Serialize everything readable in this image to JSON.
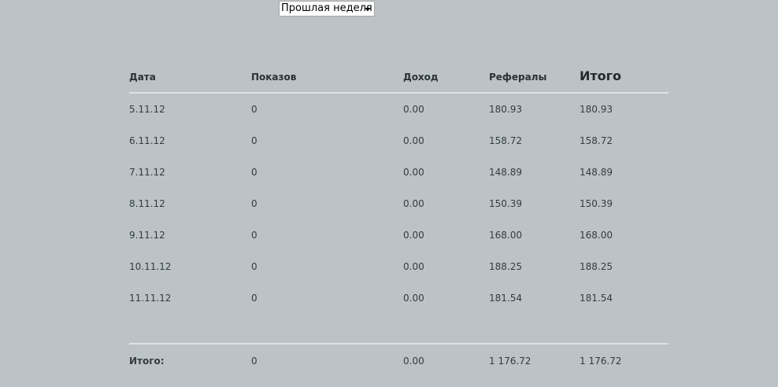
{
  "filter": {
    "period_selected": "Прошлая неделя",
    "arrow_icon": "caret-down-icon"
  },
  "table": {
    "headers": {
      "date": "Дата",
      "impressions": "Показов",
      "income": "Доход",
      "referrals": "Рефералы",
      "total": "Итого"
    },
    "rows": [
      {
        "date": "5.11.12",
        "impressions": "0",
        "income": "0.00",
        "referrals": "180.93",
        "total": "180.93"
      },
      {
        "date": "6.11.12",
        "impressions": "0",
        "income": "0.00",
        "referrals": "158.72",
        "total": "158.72"
      },
      {
        "date": "7.11.12",
        "impressions": "0",
        "income": "0.00",
        "referrals": "148.89",
        "total": "148.89"
      },
      {
        "date": "8.11.12",
        "impressions": "0",
        "income": "0.00",
        "referrals": "150.39",
        "total": "150.39"
      },
      {
        "date": "9.11.12",
        "impressions": "0",
        "income": "0.00",
        "referrals": "168.00",
        "total": "168.00"
      },
      {
        "date": "10.11.12",
        "impressions": "0",
        "income": "0.00",
        "referrals": "188.25",
        "total": "188.25"
      },
      {
        "date": "11.11.12",
        "impressions": "0",
        "income": "0.00",
        "referrals": "181.54",
        "total": "181.54"
      }
    ],
    "footer": {
      "label": "Итого:",
      "impressions": "0",
      "income": "0.00",
      "referrals": "1 176.72",
      "total": "1 176.72"
    }
  },
  "colors": {
    "background": "#bbc3c6",
    "divider": "#dde2e4",
    "text": "#353c3f"
  }
}
